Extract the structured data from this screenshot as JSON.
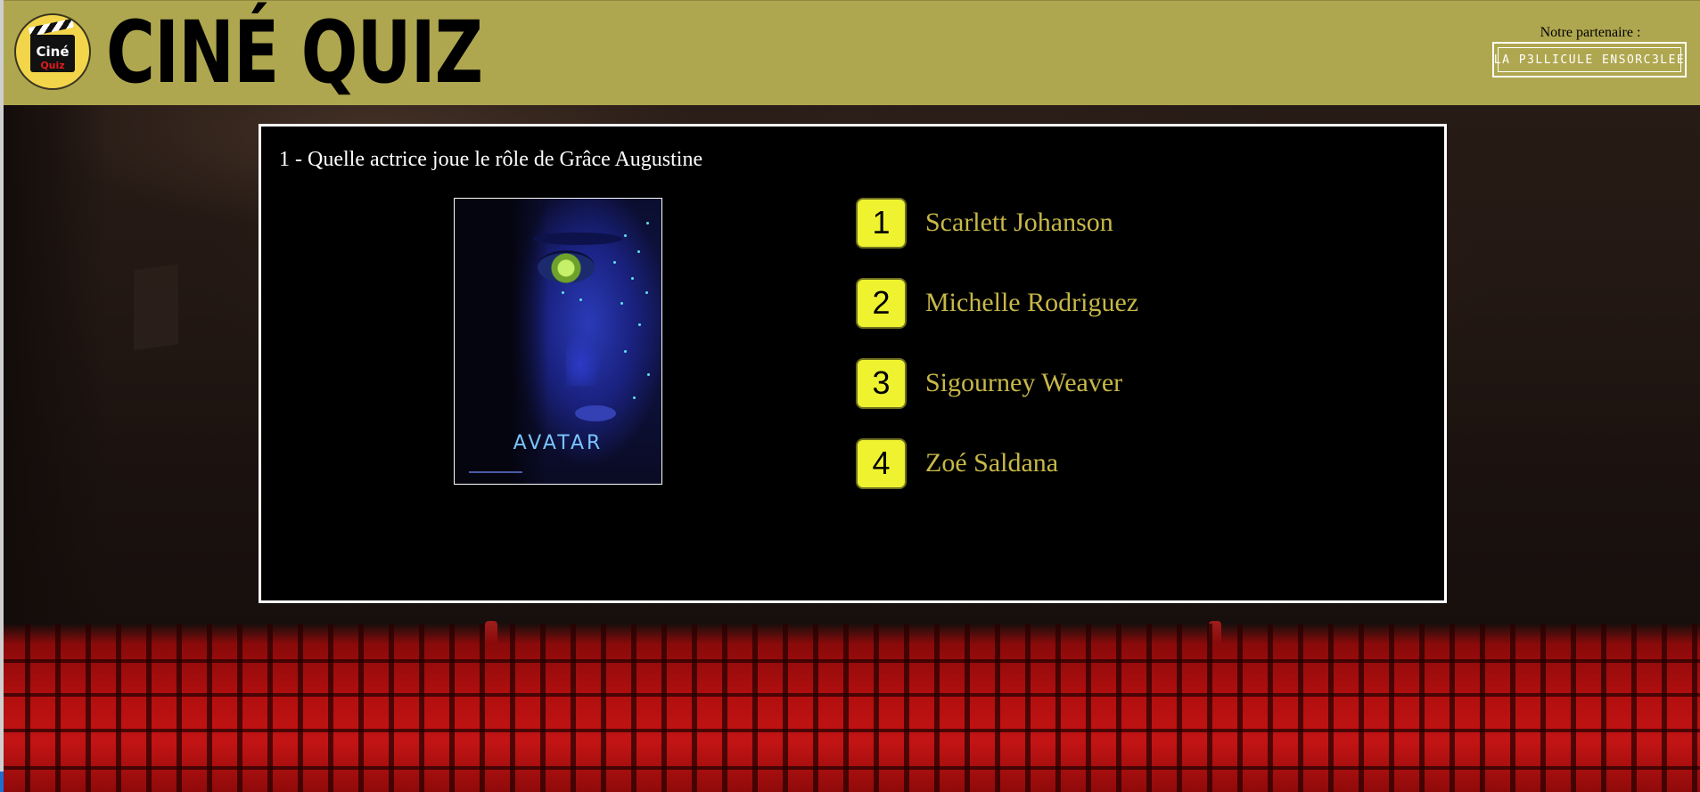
{
  "header": {
    "logo": {
      "line1": "Ciné",
      "line2": "Quiz"
    },
    "title": "CINÉ QUIZ",
    "partner_label": "Notre partenaire :",
    "partner_logo_text": "LA P3LLICULE ENSORC3LEE"
  },
  "quiz": {
    "question": "1 - Quelle actrice joue le rôle de Grâce Augustine",
    "poster": {
      "title": "AVATAR"
    },
    "answers": [
      {
        "number": "1",
        "label": "Scarlett Johanson"
      },
      {
        "number": "2",
        "label": "Michelle Rodriguez"
      },
      {
        "number": "3",
        "label": "Sigourney Weaver"
      },
      {
        "number": "4",
        "label": "Zoé Saldana"
      }
    ]
  },
  "colors": {
    "header_bg": "#afa74f",
    "answer_badge": "#eff32f",
    "answer_text": "#c7b848",
    "panel_bg": "#000000",
    "panel_border": "#ffffff"
  }
}
